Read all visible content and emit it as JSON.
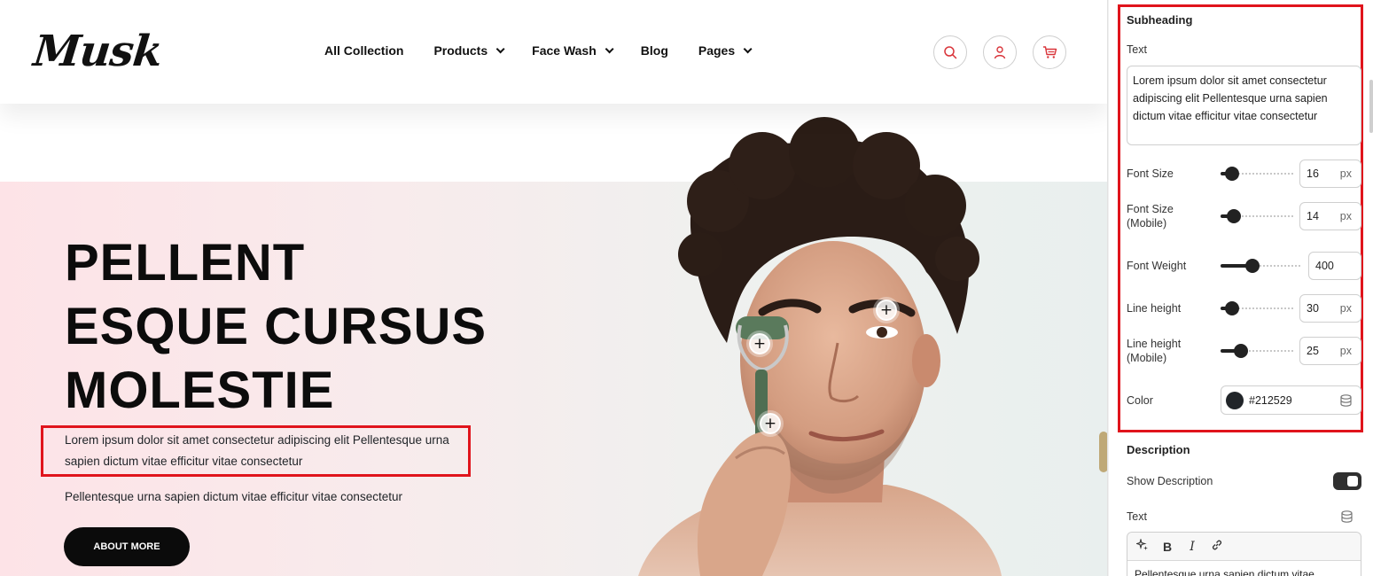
{
  "site": {
    "logo": "Musk",
    "nav": [
      {
        "label": "All Collection"
      },
      {
        "label": "Products"
      },
      {
        "label": "Face Wash"
      },
      {
        "label": "Blog"
      },
      {
        "label": "Pages"
      }
    ],
    "icons": [
      "search-icon",
      "user-icon",
      "cart-icon"
    ]
  },
  "hero": {
    "title_lines": [
      "PELLENT",
      "ESQUE CURSUS",
      "MOLESTIE"
    ],
    "subheading": "Lorem ipsum dolor sit amet consectetur adipiscing elit Pellentesque urna sapien dictum vitae efficitur vitae consectetur",
    "description": "Pellentesque urna sapien dictum vitae efficitur vitae consectetur",
    "button": "ABOUT MORE",
    "hotspot_glyph": "+"
  },
  "panel": {
    "section_title": "Subheading",
    "text_label": "Text",
    "text_value": "Lorem ipsum dolor sit amet consectetur adipiscing elit Pellentesque urna sapien dictum vitae efficitur vitae consectetur",
    "font_size": {
      "label": "Font Size",
      "value": "16",
      "unit": "px"
    },
    "font_size_mobile": {
      "label_1": "Font Size",
      "label_2": "(Mobile)",
      "value": "14",
      "unit": "px"
    },
    "font_weight": {
      "label": "Font Weight",
      "value": "400"
    },
    "line_height": {
      "label": "Line height",
      "value": "30",
      "unit": "px"
    },
    "line_height_mobile": {
      "label_1": "Line height",
      "label_2": "(Mobile)",
      "value": "25",
      "unit": "px"
    },
    "color": {
      "label": "Color",
      "value": "#212529",
      "hex": "#212529"
    },
    "description_title": "Description",
    "show_description": {
      "label": "Show Description",
      "on": true
    },
    "desc_text_label": "Text",
    "rte_toolbar": {
      "bold": "B",
      "italic": "I"
    },
    "desc_text_value": "Pellentesque urna sapien dictum vitae"
  },
  "colors": {
    "accent_red": "#e0141c",
    "dark": "#0b0b0b",
    "icon_red": "#d9343a"
  }
}
